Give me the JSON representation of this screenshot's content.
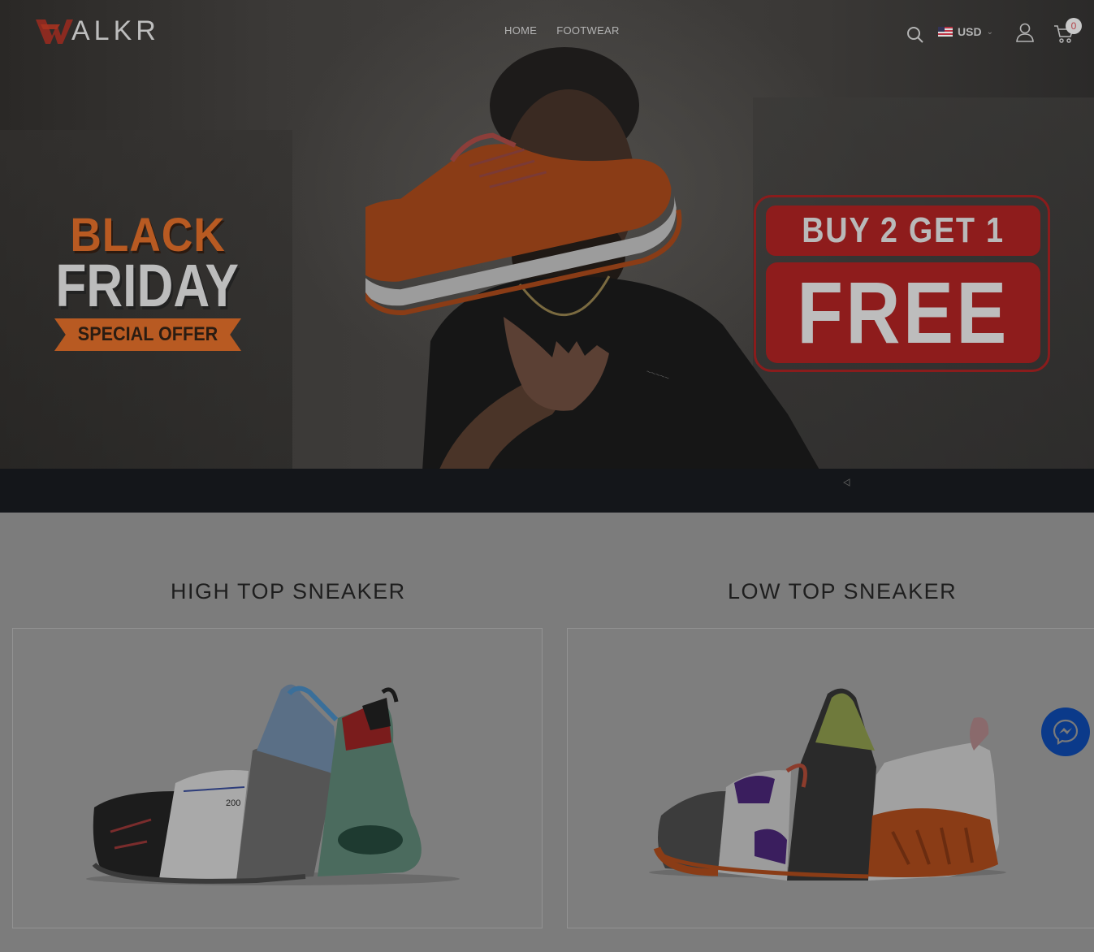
{
  "header": {
    "logo_text": "ALKR",
    "nav": [
      {
        "label": "HOME"
      },
      {
        "label": "FOOTWEAR"
      }
    ],
    "currency": "USD",
    "cart_count": "0"
  },
  "hero": {
    "black_label": "BLACK",
    "friday_label": "FRIDAY",
    "special_offer": "SPECIAL OFFER",
    "promo_top": "BUY 2 GET 1",
    "promo_bottom": "FREE"
  },
  "categories": [
    {
      "title": "HIGH TOP SNEAKER"
    },
    {
      "title": "LOW TOP SNEAKER"
    }
  ],
  "colors": {
    "accent_orange": "#b85a22",
    "promo_red": "#8e1c1c",
    "overlay_gray": "#7c7c7c",
    "messenger_blue": "#0b3a8a"
  },
  "icons": [
    "search-icon",
    "user-icon",
    "cart-icon",
    "chevron-down-icon",
    "messenger-icon"
  ]
}
